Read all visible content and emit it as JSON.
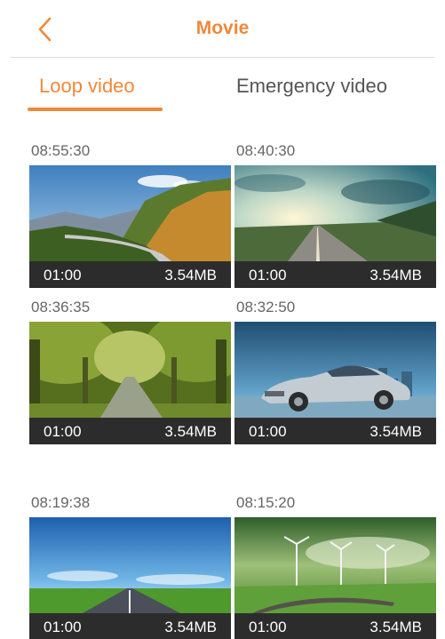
{
  "header": {
    "title": "Movie",
    "back_icon": "chevron-left-icon",
    "accent_color": "#f0883a"
  },
  "tabs": [
    {
      "label": "Loop video",
      "active": true
    },
    {
      "label": "Emergency video",
      "active": false
    }
  ],
  "videos": [
    {
      "time": "08:55:30",
      "duration": "01:00",
      "size": "3.54MB",
      "thumbnail": "mountain-road-image"
    },
    {
      "time": "08:40:30",
      "duration": "01:00",
      "size": "3.54MB",
      "thumbnail": "sunlit-highway-image"
    },
    {
      "time": "08:36:35",
      "duration": "01:00",
      "size": "3.54MB",
      "thumbnail": "tree-tunnel-road-image"
    },
    {
      "time": "08:32:50",
      "duration": "01:00",
      "size": "3.54MB",
      "thumbnail": "silver-car-image"
    },
    {
      "time": "08:19:38",
      "duration": "01:00",
      "size": "3.54MB",
      "thumbnail": "open-road-sky-image"
    },
    {
      "time": "08:15:20",
      "duration": "01:00",
      "size": "3.54MB",
      "thumbnail": "wind-turbines-image"
    }
  ]
}
